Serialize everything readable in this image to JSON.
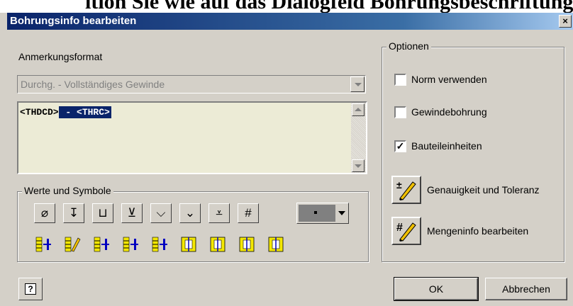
{
  "background_text": "ition Sie wie auf das Dialogfeld Bohrungsbeschriftung",
  "window": {
    "title": "Bohrungsinfo bearbeiten",
    "close_glyph": "×"
  },
  "annotation": {
    "label": "Anmerkungsformat",
    "combo_value": "Durchg. - Vollständiges Gewinde",
    "text_plain": "<THDCD>",
    "text_selected": " - <THRC>"
  },
  "values_symbols": {
    "legend": "Werte und Symbole",
    "symbols": [
      {
        "name": "diameter-icon",
        "glyph": "⌀"
      },
      {
        "name": "depth-icon",
        "glyph": "↧"
      },
      {
        "name": "counterbore-icon",
        "glyph": "⊔"
      },
      {
        "name": "spotface-icon",
        "glyph": "⊻"
      },
      {
        "name": "countersink-icon",
        "glyph": "⌵"
      },
      {
        "name": "center-drill-icon",
        "glyph": "⌄"
      },
      {
        "name": "thread-depth-icon",
        "glyph": "⩡"
      },
      {
        "name": "number-sign-icon",
        "glyph": "#"
      }
    ],
    "color_accent": "#f4e800"
  },
  "options": {
    "legend": "Optionen",
    "norm_label": "Norm verwenden",
    "norm_checked": false,
    "thread_label": "Gewindebohrung",
    "thread_checked": false,
    "units_label": "Bauteileinheiten",
    "units_checked": true,
    "checkmark": "✓",
    "precision_label": "Genauigkeit und Toleranz",
    "quantity_label": "Mengeninfo bearbeiten"
  },
  "buttons": {
    "ok": "OK",
    "cancel": "Abbrechen",
    "help": "?"
  }
}
